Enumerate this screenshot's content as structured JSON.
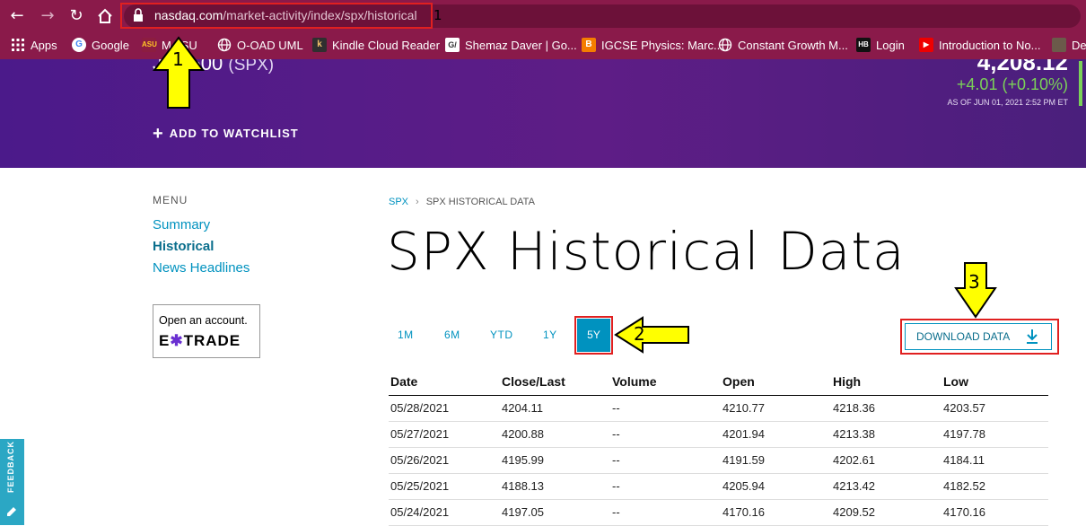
{
  "browser": {
    "url_host": "nasdaq.com",
    "url_path": "/market-activity/index/spx/historical",
    "bookmarks": [
      {
        "label": "Apps",
        "icon": "apps-grid-icon"
      },
      {
        "label": "Google",
        "icon": "google-icon"
      },
      {
        "label": "M   SU",
        "icon": "asu-icon"
      },
      {
        "label": "O-OAD UML",
        "icon": "globe-icon"
      },
      {
        "label": "Kindle Cloud Reader",
        "icon": "kindle-icon"
      },
      {
        "label": "Shemaz Daver | Go...",
        "icon": "gc-icon"
      },
      {
        "label": "IGCSE Physics: Marc...",
        "icon": "blogger-icon"
      },
      {
        "label": "Constant Growth M...",
        "icon": "globe-icon"
      },
      {
        "label": "Login",
        "icon": "hb-icon"
      },
      {
        "label": "Introduction to No...",
        "icon": "youtube-icon"
      },
      {
        "label": "De",
        "icon": "avatar-icon"
      }
    ]
  },
  "header": {
    "index_name": "J     500",
    "symbol": "(SPX)",
    "price": "4,208.12",
    "change": "+4.01 (+0.10%)",
    "as_of": "AS OF JUN 01, 2021 2:52 PM ET",
    "watchlist_label": "ADD TO WATCHLIST"
  },
  "menu": {
    "label": "MENU",
    "items": [
      "Summary",
      "Historical",
      "News Headlines"
    ],
    "active_index": 1
  },
  "ad": {
    "line1": "Open an account.",
    "brand_pre": "E",
    "brand_star": "✱",
    "brand_post": "TRADE"
  },
  "breadcrumb": {
    "root": "SPX",
    "current": "SPX HISTORICAL DATA"
  },
  "page_title": "SPX Historical Data",
  "timeframes": [
    "1M",
    "6M",
    "YTD",
    "1Y",
    "5Y"
  ],
  "selected_timeframe": "5Y",
  "download_label": "DOWNLOAD DATA",
  "table": {
    "columns": [
      "Date",
      "Close/Last",
      "Volume",
      "Open",
      "High",
      "Low"
    ],
    "rows": [
      [
        "05/28/2021",
        "4204.11",
        "--",
        "4210.77",
        "4218.36",
        "4203.57"
      ],
      [
        "05/27/2021",
        "4200.88",
        "--",
        "4201.94",
        "4213.38",
        "4197.78"
      ],
      [
        "05/26/2021",
        "4195.99",
        "--",
        "4191.59",
        "4202.61",
        "4184.11"
      ],
      [
        "05/25/2021",
        "4188.13",
        "--",
        "4205.94",
        "4213.42",
        "4182.52"
      ],
      [
        "05/24/2021",
        "4197.05",
        "--",
        "4170.16",
        "4209.52",
        "4170.16"
      ]
    ]
  },
  "annotations": [
    "1",
    "1",
    "2",
    "3"
  ],
  "feedback_label": "FEEDBACK",
  "colors": {
    "accent": "#0092bf",
    "band": "#5e1d86",
    "positive": "#7bd158",
    "highlight_box": "#e02020",
    "arrow": "#ffff00"
  }
}
